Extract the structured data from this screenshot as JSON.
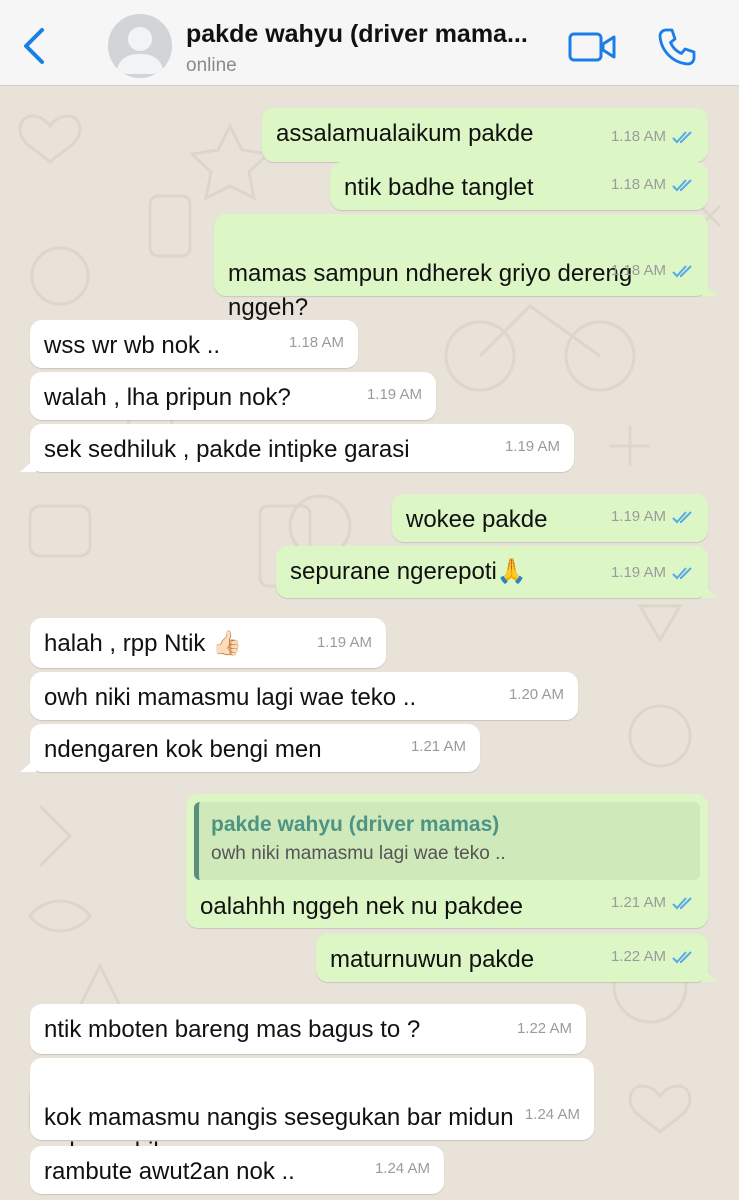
{
  "header": {
    "back_label": "Back",
    "contact_name": "pakde wahyu (driver mama...",
    "status": "online"
  },
  "colors": {
    "accent": "#1a7ee8",
    "outgoing_bubble": "#dcf7c5",
    "incoming_bubble": "#ffffff",
    "read_ticks": "#5aa8e6",
    "quote_name": "#4e9484"
  },
  "messages": [
    {
      "direction": "out",
      "text": "assalamualaikum pakde",
      "time": "1.18 AM",
      "status": "read"
    },
    {
      "direction": "out",
      "text": "ntik badhe tanglet",
      "time": "1.18 AM",
      "status": "read"
    },
    {
      "direction": "out",
      "text": "mamas sampun ndherek griyo dereng\nnggeh?",
      "time": "1.18 AM",
      "status": "read"
    },
    {
      "direction": "in",
      "text": "wss wr wb nok ..",
      "time": "1.18 AM"
    },
    {
      "direction": "in",
      "text": "walah , lha pripun nok?",
      "time": "1.19 AM"
    },
    {
      "direction": "in",
      "text": "sek sedhiluk , pakde intipke garasi",
      "time": "1.19 AM"
    },
    {
      "direction": "out",
      "text": "wokee pakde",
      "time": "1.19 AM",
      "status": "read"
    },
    {
      "direction": "out",
      "text": "sepurane ngerepoti",
      "emoji": "🙏",
      "time": "1.19 AM",
      "status": "read"
    },
    {
      "direction": "in",
      "text": "halah , rpp Ntik",
      "emoji": "👍🏻",
      "time": "1.19 AM"
    },
    {
      "direction": "in",
      "text": "owh niki mamasmu lagi wae teko ..",
      "time": "1.20 AM"
    },
    {
      "direction": "in",
      "text": "ndengaren kok bengi men",
      "time": "1.21 AM"
    },
    {
      "direction": "out",
      "text": "oalahhh nggeh nek nu pakdee",
      "time": "1.21 AM",
      "status": "read",
      "quote": {
        "name": "pakde wahyu (driver mamas)",
        "text": "owh niki mamasmu lagi wae teko .."
      }
    },
    {
      "direction": "out",
      "text": "maturnuwun pakde",
      "time": "1.22 AM",
      "status": "read"
    },
    {
      "direction": "in",
      "text": "ntik mboten bareng mas bagus to ?",
      "time": "1.22 AM"
    },
    {
      "direction": "in",
      "text": "kok mamasmu nangis sesegukan bar midun\nseko mobil",
      "time": "1.24 AM"
    },
    {
      "direction": "in",
      "text": "rambute awut2an nok ..",
      "time": "1.24 AM"
    }
  ]
}
